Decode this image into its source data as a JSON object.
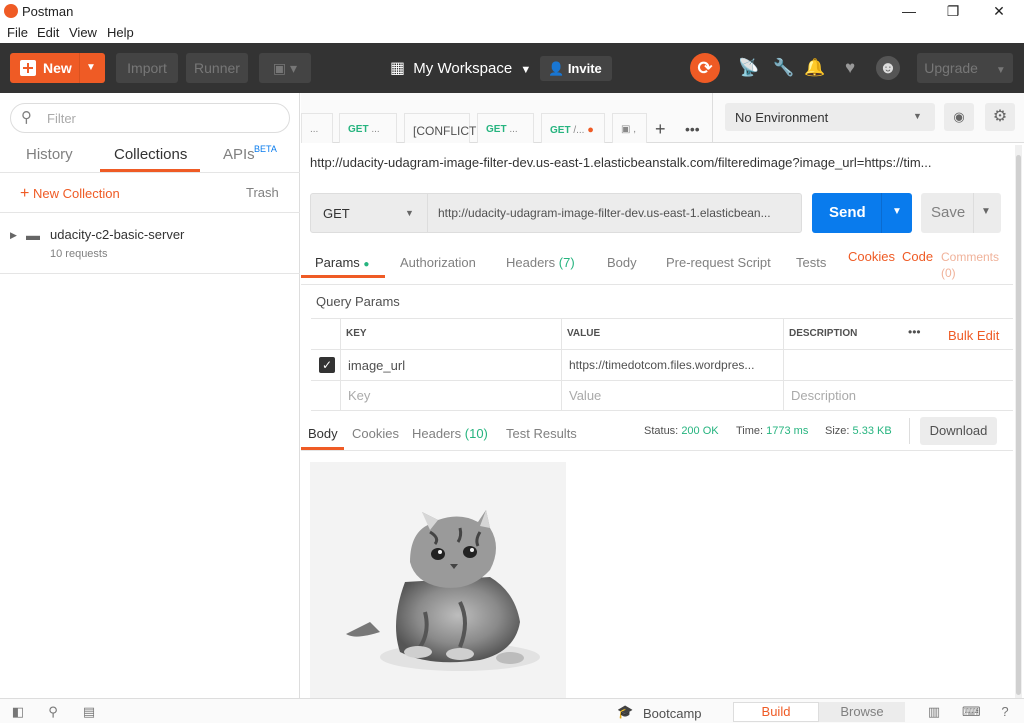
{
  "window": {
    "title": "Postman",
    "minimize": "—",
    "maximize": "❐",
    "close": "✕"
  },
  "menu": {
    "items": [
      "File",
      "Edit",
      "View",
      "Help"
    ]
  },
  "header": {
    "new_label": "New",
    "import_label": "Import",
    "runner_label": "Runner",
    "workspace_label": "My Workspace",
    "invite_label": "Invite",
    "upgrade_label": "Upgrade",
    "accent": "#ef5b25"
  },
  "sidebar": {
    "filter_placeholder": "Filter",
    "tabs": {
      "history": "History",
      "collections": "Collections",
      "apis": "APIs",
      "beta": "BETA"
    },
    "new_collection": "New Collection",
    "trash": "Trash",
    "collection": {
      "name": "udacity-c2-basic-server",
      "sub": "10 requests"
    }
  },
  "request_tabs": [
    {
      "method": "",
      "label": "..."
    },
    {
      "method": "GET",
      "label": "..."
    },
    {
      "method": "",
      "label": "[CONFLICT"
    },
    {
      "method": "GET",
      "label": "..."
    },
    {
      "method": "GET",
      "label": "/..."
    }
  ],
  "environment": {
    "selected": "No Environment"
  },
  "request": {
    "title_url": "http://udacity-udagram-image-filter-dev.us-east-1.elasticbeanstalk.com/filteredimage?image_url=https://tim...",
    "method": "GET",
    "url": "http://udacity-udagram-image-filter-dev.us-east-1.elasticbean...",
    "send_label": "Send",
    "save_label": "Save"
  },
  "request_sections": {
    "params": "Params",
    "authorization": "Authorization",
    "headers": "Headers",
    "headers_count": "(7)",
    "body": "Body",
    "prerequest": "Pre-request Script",
    "tests": "Tests",
    "cookies": "Cookies",
    "code": "Code",
    "comments": "Comments",
    "comments_count": "(0)"
  },
  "query_params": {
    "title": "Query Params",
    "headers": {
      "key": "KEY",
      "value": "VALUE",
      "description": "DESCRIPTION",
      "bulk_edit": "Bulk Edit"
    },
    "rows": [
      {
        "key": "image_url",
        "value": "https://timedotcom.files.wordpres...",
        "description": ""
      }
    ],
    "placeholders": {
      "key": "Key",
      "value": "Value",
      "description": "Description"
    }
  },
  "response": {
    "tabs": {
      "body": "Body",
      "cookies": "Cookies",
      "headers": "Headers",
      "headers_count": "(10)",
      "tests": "Test Results"
    },
    "status_label": "Status:",
    "status_value": "200 OK",
    "time_label": "Time:",
    "time_value": "1773 ms",
    "size_label": "Size:",
    "size_value": "5.33 KB",
    "download_label": "Download"
  },
  "statusbar": {
    "bootcamp": "Bootcamp",
    "build": "Build",
    "browse": "Browse"
  }
}
